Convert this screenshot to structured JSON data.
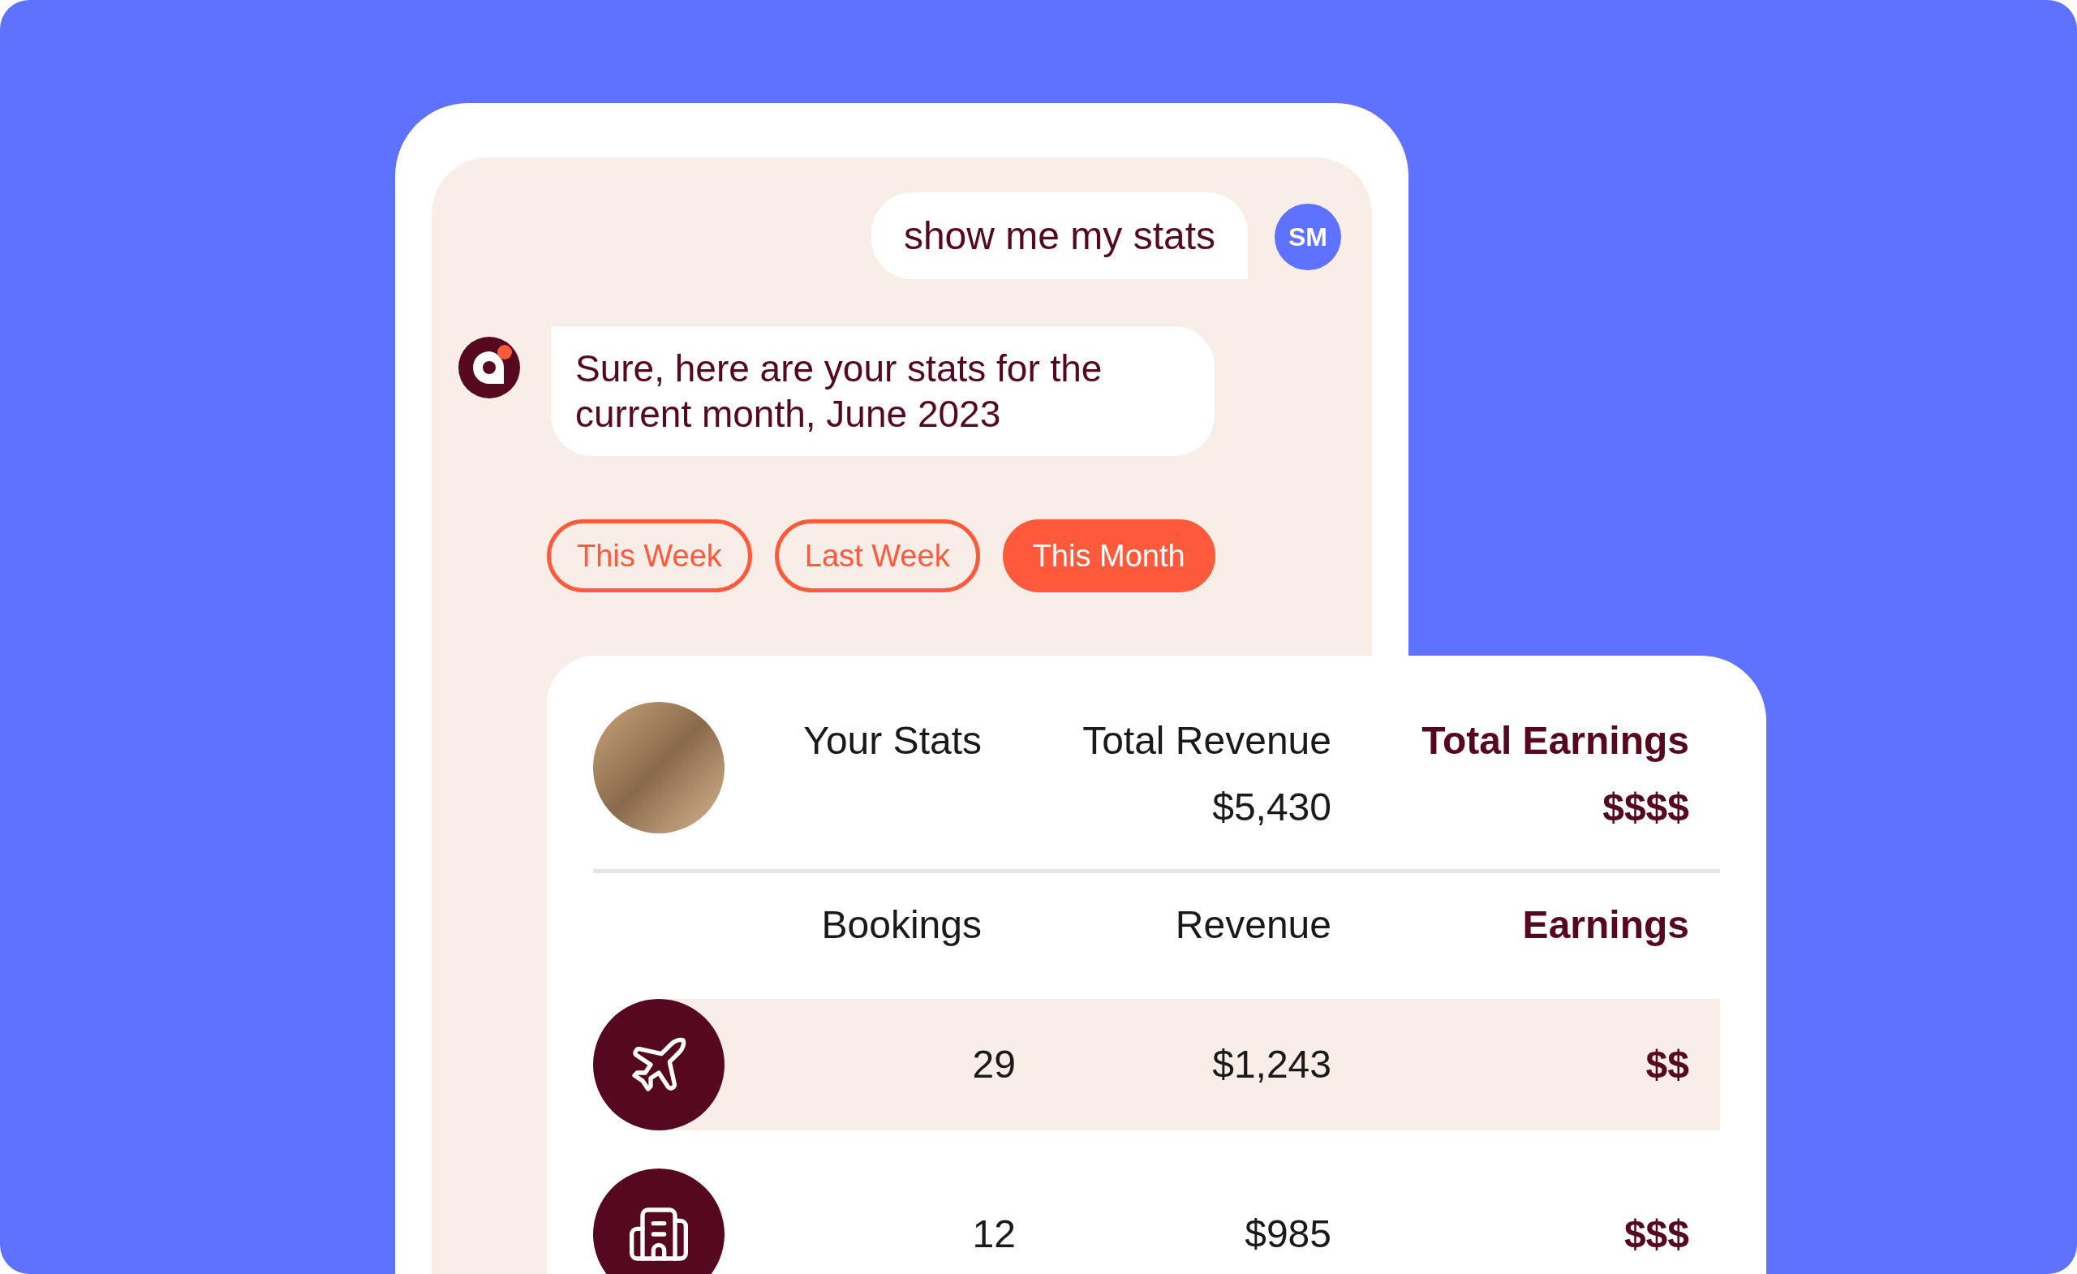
{
  "chat": {
    "messages": [
      {
        "kind": "user",
        "text": "show me my stats",
        "avatar": "SM"
      },
      {
        "kind": "bot",
        "text": "Sure, here are your stats for the current month, June 2023"
      }
    ]
  },
  "filters": [
    {
      "label": "This Week",
      "selected": false
    },
    {
      "label": "Last Week",
      "selected": false
    },
    {
      "label": "This Month",
      "selected": true
    }
  ],
  "stats": {
    "title": "Your Stats",
    "totals": [
      {
        "label": "Total Revenue",
        "value": "$5,430",
        "emphasis": false
      },
      {
        "label": "Total Earnings",
        "value": "$$$$",
        "emphasis": true
      }
    ],
    "columns": [
      {
        "label": "Bookings",
        "emphasis": false
      },
      {
        "label": "Revenue",
        "emphasis": false
      },
      {
        "label": "Earnings",
        "emphasis": true
      }
    ],
    "rows": [
      {
        "kind": "flight",
        "bookings": "29",
        "revenue": "$1,243",
        "earnings": "$$",
        "highlighted": true
      },
      {
        "kind": "hotel",
        "bookings": "12",
        "revenue": "$985",
        "earnings": "$$$",
        "highlighted": false
      }
    ]
  }
}
